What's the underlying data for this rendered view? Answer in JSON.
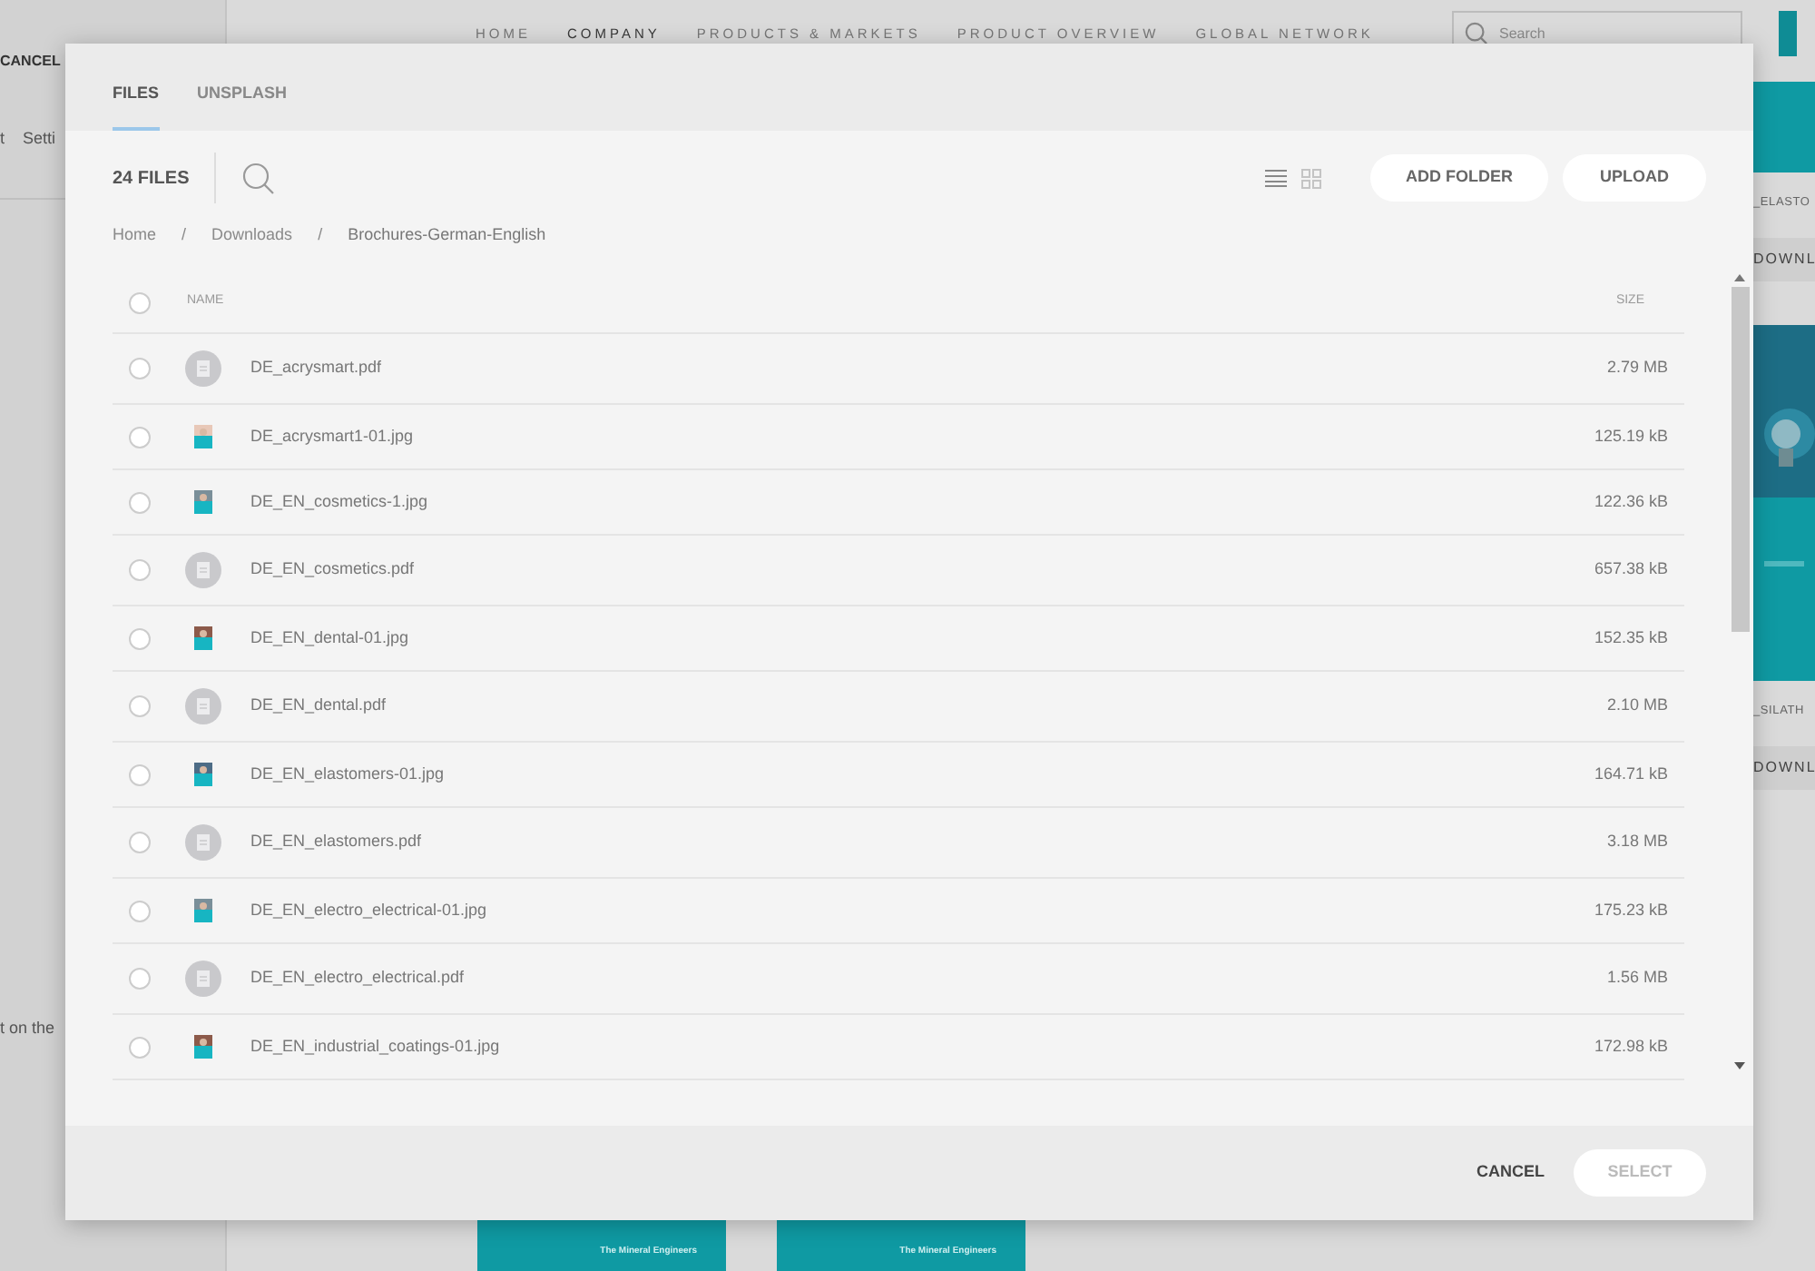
{
  "background_page": {
    "nav": [
      {
        "label": "HOME",
        "selected": false
      },
      {
        "label": "COMPANY",
        "selected": true
      },
      {
        "label": "PRODUCTS & MARKETS",
        "selected": false
      },
      {
        "label": "PRODUCT OVERVIEW",
        "selected": false
      },
      {
        "label": "GLOBAL NETWORK",
        "selected": false
      }
    ],
    "search": {
      "placeholder": "Search"
    },
    "left_panel": {
      "cancel": "CANCEL",
      "tabs": [
        "t",
        "Setti"
      ],
      "note": "t on the"
    },
    "right_column": {
      "labels": [
        "_ELASTO",
        "_SILATH"
      ],
      "buttons": [
        "DOWNL",
        "DOWNL"
      ]
    },
    "thumbnails": [
      {
        "caption": "The Mineral Engineers"
      },
      {
        "caption": "The Mineral Engineers"
      }
    ]
  },
  "modal": {
    "tabs": [
      {
        "label": "FILES",
        "selected": true
      },
      {
        "label": "UNSPLASH",
        "selected": false
      }
    ],
    "file_count": "24 FILES",
    "view_toggle": [
      {
        "kind": "list",
        "selected": true
      },
      {
        "kind": "grid",
        "selected": false
      }
    ],
    "buttons": [
      "ADD FOLDER",
      "UPLOAD"
    ],
    "breadcrumb": [
      {
        "kind": "link",
        "label": "Home"
      },
      {
        "kind": "separator",
        "label": "/"
      },
      {
        "kind": "link",
        "label": "Downloads"
      },
      {
        "kind": "separator",
        "label": "/"
      },
      {
        "kind": "current",
        "label": "Brochures-German-English"
      }
    ],
    "table": {
      "columns": [
        "NAME",
        "SIZE"
      ],
      "all_selected": false,
      "rows": [
        {
          "kind": "pdf",
          "name": "DE_acrysmart.pdf",
          "size": "2.79 MB",
          "selected": false
        },
        {
          "name": "DE_acrysmart1-01.jpg",
          "size": "125.19 kB",
          "selected": false
        },
        {
          "name": "DE_EN_cosmetics-1.jpg",
          "size": "122.36 kB",
          "selected": false
        },
        {
          "kind": "pdf",
          "name": "DE_EN_cosmetics.pdf",
          "size": "657.38 kB",
          "selected": false
        },
        {
          "name": "DE_EN_dental-01.jpg",
          "size": "152.35 kB",
          "selected": false
        },
        {
          "kind": "pdf",
          "name": "DE_EN_dental.pdf",
          "size": "2.10 MB",
          "selected": false
        },
        {
          "name": "DE_EN_elastomers-01.jpg",
          "size": "164.71 kB",
          "selected": false
        },
        {
          "kind": "pdf",
          "name": "DE_EN_elastomers.pdf",
          "size": "3.18 MB",
          "selected": false
        },
        {
          "name": "DE_EN_electro_electrical-01.jpg",
          "size": "175.23 kB",
          "selected": false
        },
        {
          "kind": "pdf",
          "name": "DE_EN_electro_electrical.pdf",
          "size": "1.56 MB",
          "selected": false
        },
        {
          "name": "DE_EN_industrial_coatings-01.jpg",
          "size": "172.98 kB",
          "selected": false
        }
      ]
    },
    "footer": {
      "cancel": "CANCEL",
      "select": {
        "label": "SELECT",
        "disabled": true
      }
    }
  }
}
